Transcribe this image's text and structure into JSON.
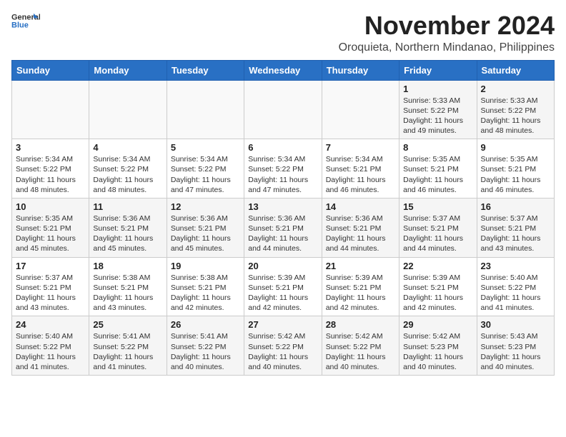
{
  "header": {
    "logo_line1": "General",
    "logo_line2": "Blue",
    "month": "November 2024",
    "location": "Oroquieta, Northern Mindanao, Philippines"
  },
  "weekdays": [
    "Sunday",
    "Monday",
    "Tuesday",
    "Wednesday",
    "Thursday",
    "Friday",
    "Saturday"
  ],
  "weeks": [
    [
      {
        "day": "",
        "info": ""
      },
      {
        "day": "",
        "info": ""
      },
      {
        "day": "",
        "info": ""
      },
      {
        "day": "",
        "info": ""
      },
      {
        "day": "",
        "info": ""
      },
      {
        "day": "1",
        "info": "Sunrise: 5:33 AM\nSunset: 5:22 PM\nDaylight: 11 hours and 49 minutes."
      },
      {
        "day": "2",
        "info": "Sunrise: 5:33 AM\nSunset: 5:22 PM\nDaylight: 11 hours and 48 minutes."
      }
    ],
    [
      {
        "day": "3",
        "info": "Sunrise: 5:34 AM\nSunset: 5:22 PM\nDaylight: 11 hours and 48 minutes."
      },
      {
        "day": "4",
        "info": "Sunrise: 5:34 AM\nSunset: 5:22 PM\nDaylight: 11 hours and 48 minutes."
      },
      {
        "day": "5",
        "info": "Sunrise: 5:34 AM\nSunset: 5:22 PM\nDaylight: 11 hours and 47 minutes."
      },
      {
        "day": "6",
        "info": "Sunrise: 5:34 AM\nSunset: 5:22 PM\nDaylight: 11 hours and 47 minutes."
      },
      {
        "day": "7",
        "info": "Sunrise: 5:34 AM\nSunset: 5:21 PM\nDaylight: 11 hours and 46 minutes."
      },
      {
        "day": "8",
        "info": "Sunrise: 5:35 AM\nSunset: 5:21 PM\nDaylight: 11 hours and 46 minutes."
      },
      {
        "day": "9",
        "info": "Sunrise: 5:35 AM\nSunset: 5:21 PM\nDaylight: 11 hours and 46 minutes."
      }
    ],
    [
      {
        "day": "10",
        "info": "Sunrise: 5:35 AM\nSunset: 5:21 PM\nDaylight: 11 hours and 45 minutes."
      },
      {
        "day": "11",
        "info": "Sunrise: 5:36 AM\nSunset: 5:21 PM\nDaylight: 11 hours and 45 minutes."
      },
      {
        "day": "12",
        "info": "Sunrise: 5:36 AM\nSunset: 5:21 PM\nDaylight: 11 hours and 45 minutes."
      },
      {
        "day": "13",
        "info": "Sunrise: 5:36 AM\nSunset: 5:21 PM\nDaylight: 11 hours and 44 minutes."
      },
      {
        "day": "14",
        "info": "Sunrise: 5:36 AM\nSunset: 5:21 PM\nDaylight: 11 hours and 44 minutes."
      },
      {
        "day": "15",
        "info": "Sunrise: 5:37 AM\nSunset: 5:21 PM\nDaylight: 11 hours and 44 minutes."
      },
      {
        "day": "16",
        "info": "Sunrise: 5:37 AM\nSunset: 5:21 PM\nDaylight: 11 hours and 43 minutes."
      }
    ],
    [
      {
        "day": "17",
        "info": "Sunrise: 5:37 AM\nSunset: 5:21 PM\nDaylight: 11 hours and 43 minutes."
      },
      {
        "day": "18",
        "info": "Sunrise: 5:38 AM\nSunset: 5:21 PM\nDaylight: 11 hours and 43 minutes."
      },
      {
        "day": "19",
        "info": "Sunrise: 5:38 AM\nSunset: 5:21 PM\nDaylight: 11 hours and 42 minutes."
      },
      {
        "day": "20",
        "info": "Sunrise: 5:39 AM\nSunset: 5:21 PM\nDaylight: 11 hours and 42 minutes."
      },
      {
        "day": "21",
        "info": "Sunrise: 5:39 AM\nSunset: 5:21 PM\nDaylight: 11 hours and 42 minutes."
      },
      {
        "day": "22",
        "info": "Sunrise: 5:39 AM\nSunset: 5:21 PM\nDaylight: 11 hours and 42 minutes."
      },
      {
        "day": "23",
        "info": "Sunrise: 5:40 AM\nSunset: 5:22 PM\nDaylight: 11 hours and 41 minutes."
      }
    ],
    [
      {
        "day": "24",
        "info": "Sunrise: 5:40 AM\nSunset: 5:22 PM\nDaylight: 11 hours and 41 minutes."
      },
      {
        "day": "25",
        "info": "Sunrise: 5:41 AM\nSunset: 5:22 PM\nDaylight: 11 hours and 41 minutes."
      },
      {
        "day": "26",
        "info": "Sunrise: 5:41 AM\nSunset: 5:22 PM\nDaylight: 11 hours and 40 minutes."
      },
      {
        "day": "27",
        "info": "Sunrise: 5:42 AM\nSunset: 5:22 PM\nDaylight: 11 hours and 40 minutes."
      },
      {
        "day": "28",
        "info": "Sunrise: 5:42 AM\nSunset: 5:22 PM\nDaylight: 11 hours and 40 minutes."
      },
      {
        "day": "29",
        "info": "Sunrise: 5:42 AM\nSunset: 5:23 PM\nDaylight: 11 hours and 40 minutes."
      },
      {
        "day": "30",
        "info": "Sunrise: 5:43 AM\nSunset: 5:23 PM\nDaylight: 11 hours and 40 minutes."
      }
    ]
  ]
}
